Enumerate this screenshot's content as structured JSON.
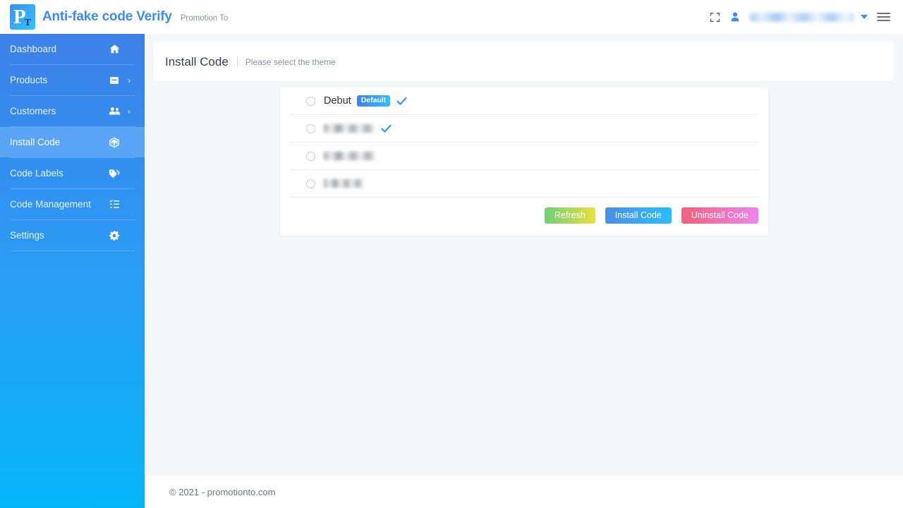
{
  "header": {
    "logo": {
      "letter_primary": "P",
      "letter_secondary": "T"
    },
    "brand_title": "Anti-fake code Verify",
    "brand_subtitle": "Promotion To",
    "fullscreen_icon": "fullscreen-icon",
    "user_icon": "user-icon",
    "username": "",
    "dropdown_icon": "chevron-down-icon",
    "menu_icon": "hamburger-menu-icon"
  },
  "sidebar": {
    "items": [
      {
        "label": "Dashboard",
        "icon": "home-icon",
        "has_arrow": false,
        "active": false
      },
      {
        "label": "Products",
        "icon": "archive-icon",
        "has_arrow": true,
        "active": false
      },
      {
        "label": "Customers",
        "icon": "users-icon",
        "has_arrow": true,
        "active": false
      },
      {
        "label": "Install Code",
        "icon": "cube-icon",
        "has_arrow": false,
        "active": true
      },
      {
        "label": "Code Labels",
        "icon": "tag-icon",
        "has_arrow": false,
        "active": false
      },
      {
        "label": "Code Management",
        "icon": "list-icon",
        "has_arrow": false,
        "active": false
      },
      {
        "label": "Settings",
        "icon": "gear-icon",
        "has_arrow": false,
        "active": false
      }
    ]
  },
  "page": {
    "title": "Install Code",
    "subtitle": "Please select the theme"
  },
  "themes": [
    {
      "name": "Debut",
      "blurred": false,
      "badge": "Default",
      "installed": true
    },
    {
      "name": "",
      "blurred": true,
      "badge": null,
      "installed": true
    },
    {
      "name": "",
      "blurred": true,
      "badge": null,
      "installed": false
    },
    {
      "name": "",
      "blurred": true,
      "badge": null,
      "installed": false
    }
  ],
  "buttons": {
    "refresh": "Refresh",
    "install": "Install Code",
    "uninstall": "Uninstall Code"
  },
  "footer": {
    "text": "© 2021 - promotionto.com"
  },
  "colors": {
    "brand_blue": "#3b8ef0",
    "sidebar_top": "#3d80e8",
    "sidebar_bottom": "#06b6fb",
    "sidebar_active": "#5aa4f6",
    "check_blue": "#2f9cf4",
    "badge_from": "#3d82ef",
    "badge_to": "#2ec1fb",
    "btn_refresh_from": "#6ed07a",
    "btn_refresh_to": "#e9e13f",
    "btn_install_from": "#4a8fe8",
    "btn_install_to": "#2bbdfb",
    "btn_uninstall_from": "#f3607a",
    "btn_uninstall_to": "#ef84f0",
    "page_bg": "#f6f7f9"
  }
}
